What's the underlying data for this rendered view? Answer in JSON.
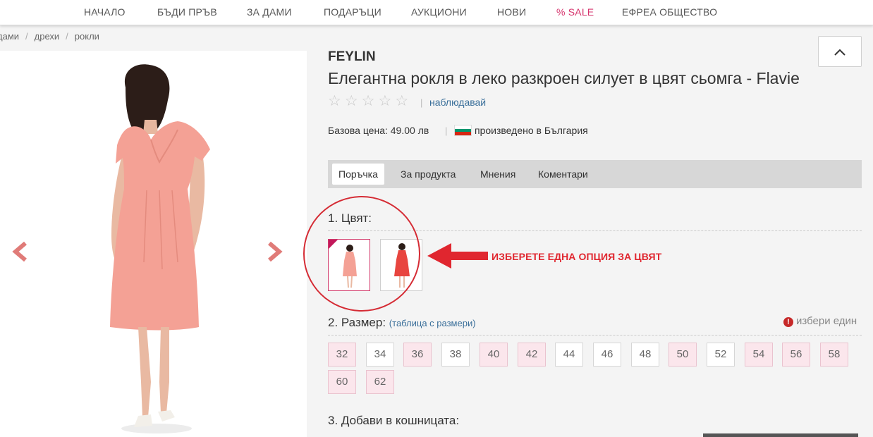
{
  "nav": {
    "items": [
      {
        "label": "НАЧАЛО"
      },
      {
        "label": "БЪДИ ПРЪВ"
      },
      {
        "label": "ЗА ДАМИ"
      },
      {
        "label": "ПОДАРЪЦИ"
      },
      {
        "label": "АУКЦИОНИ"
      },
      {
        "label": "НОВИ"
      },
      {
        "label": "% SALE"
      },
      {
        "label": "ЕФРЕА ОБЩЕСТВО"
      }
    ]
  },
  "breadcrumb": {
    "items": [
      "дами",
      "дрехи",
      "рокли"
    ],
    "separator": "/"
  },
  "product": {
    "brand": "FEYLIN",
    "title": "Елегантна рокля в леко разкроен силует в цвят сьомга - Flavie",
    "rating_stars": 5,
    "watch_label": "наблюдавай",
    "price_label": "Базова цена: 49.00 лв",
    "origin_label": "произведено в България",
    "flag_colors": [
      "#ffffff",
      "#00966e",
      "#d62612"
    ]
  },
  "tabs": [
    {
      "label": "Поръчка",
      "active": true
    },
    {
      "label": "За продукта",
      "active": false
    },
    {
      "label": "Мнения",
      "active": false
    },
    {
      "label": "Коментари",
      "active": false
    }
  ],
  "order": {
    "color_heading": "1. Цвят:",
    "color_options": [
      {
        "name": "salmon-dress",
        "selected": true,
        "dress_color": "#f4a195"
      },
      {
        "name": "red-dress",
        "selected": false,
        "dress_color": "#e8453f"
      }
    ],
    "color_callout": "ИЗБЕРЕТЕ ЕДНА ОПЦИЯ ЗА ЦВЯТ",
    "size_heading": "2. Размер:",
    "size_chart_open": "(",
    "size_chart_label": "таблица с размери",
    "size_chart_close": ")",
    "pick_one_label": "избери един",
    "sizes": [
      {
        "label": "32",
        "available": false
      },
      {
        "label": "34",
        "available": true
      },
      {
        "label": "36",
        "available": false
      },
      {
        "label": "38",
        "available": true
      },
      {
        "label": "40",
        "available": false
      },
      {
        "label": "42",
        "available": false
      },
      {
        "label": "44",
        "available": true
      },
      {
        "label": "46",
        "available": true
      },
      {
        "label": "48",
        "available": true
      },
      {
        "label": "50",
        "available": false
      },
      {
        "label": "52",
        "available": true
      },
      {
        "label": "54",
        "available": false
      },
      {
        "label": "56",
        "available": false
      },
      {
        "label": "58",
        "available": false
      },
      {
        "label": "60",
        "available": false
      },
      {
        "label": "62",
        "available": false
      }
    ],
    "add_heading": "3. Добави в кошницата:"
  },
  "colors": {
    "accent_pink": "#d6336c",
    "link_blue": "#3a6f9a",
    "annotation_red": "#e0262f",
    "arrow_coral": "#e07b78"
  }
}
